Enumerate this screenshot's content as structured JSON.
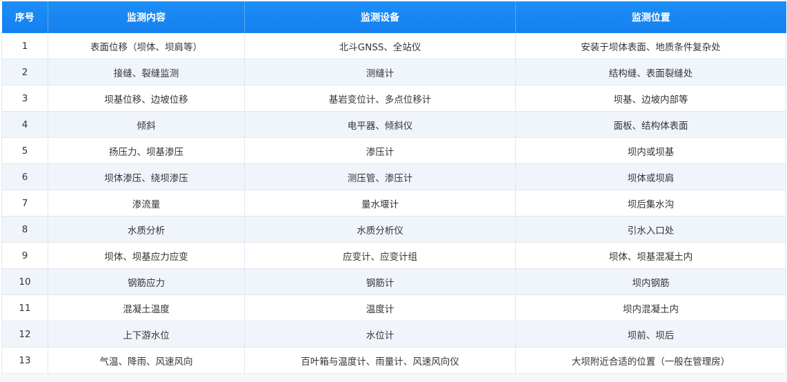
{
  "table": {
    "headers": [
      "序号",
      "监测内容",
      "监测设备",
      "监测位置"
    ],
    "rows": [
      [
        "1",
        "表面位移（坝体、坝肩等）",
        "北斗GNSS、全站仪",
        "安装于坝体表面、地质条件复杂处"
      ],
      [
        "2",
        "接缝、裂缝监测",
        "测缝计",
        "结构缝、表面裂缝处"
      ],
      [
        "3",
        "坝基位移、边坡位移",
        "基岩变位计、多点位移计",
        "坝基、边坡内部等"
      ],
      [
        "4",
        "倾斜",
        "电平器、倾斜仪",
        "面板、结构体表面"
      ],
      [
        "5",
        "扬压力、坝基渗压",
        "渗压计",
        "坝内或坝基"
      ],
      [
        "6",
        "坝体渗压、绕坝渗压",
        "测压管、渗压计",
        "坝体或坝肩"
      ],
      [
        "7",
        "渗流量",
        "量水堰计",
        "坝后集水沟"
      ],
      [
        "8",
        "水质分析",
        "水质分析仪",
        "引水入口处"
      ],
      [
        "9",
        "坝体、坝基应力应变",
        "应变计、应变计组",
        "坝体、坝基混凝土内"
      ],
      [
        "10",
        "钢筋应力",
        "钢筋计",
        "坝内钢筋"
      ],
      [
        "11",
        "混凝土温度",
        "温度计",
        "坝内混凝土内"
      ],
      [
        "12",
        "上下游水位",
        "水位计",
        "坝前、坝后"
      ],
      [
        "13",
        "气温、降雨、风速风向",
        "百叶箱与温度计、雨量计、风速风向仪",
        "大坝附近合适的位置（一般在管理房）"
      ]
    ]
  }
}
